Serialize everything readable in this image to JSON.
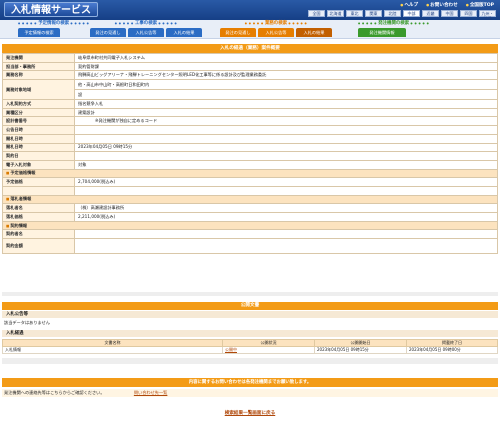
{
  "header": {
    "title": "入札情報サービス",
    "links": [
      "ヘルプ",
      "お問い合わせ",
      "全国版TOP"
    ],
    "regions": [
      [
        "全国",
        "北海道",
        "東北",
        "関東",
        "北陸",
        "中部",
        "近畿"
      ],
      [
        "中国",
        "四国",
        "九州・沖縄"
      ]
    ]
  },
  "nav": {
    "groups": [
      {
        "title": "予定情報の検索",
        "color": "#2b6cc4",
        "tabs": [
          "予定情報の検索"
        ]
      },
      {
        "title": "工事の検索",
        "color": "#2b6cc4",
        "tabs": [
          "発注の見通し",
          "入札公告等",
          "入札の結果"
        ]
      },
      {
        "title": "業務の検索",
        "color": "#e67e00",
        "tabs": [
          "発注の見通し",
          "入札公告等",
          "入札の結果"
        ]
      },
      {
        "title": "発注機関の検索",
        "color": "#3a9a2c",
        "tabs": [
          "発注機関情報"
        ]
      }
    ]
  },
  "main": {
    "title": "入札の経過（業務）案件概要",
    "rows": [
      {
        "label": "発注機関",
        "value": "岐阜県市町村共同電子入札システム"
      },
      {
        "label": "担当部・事務所",
        "value": "契約管財課"
      },
      {
        "label": "業務名称",
        "value": "飛騨高山ビッグアリーナ・飛騨トレーニングセンター照明LED化工事等に係る設計及び監理業務委託"
      },
      {
        "label": "業務対象地域",
        "value": "他・高山市中山町・高根町日和田町内"
      },
      {
        "label": "",
        "value": "設"
      },
      {
        "label": "入札契約方式",
        "value": "指名競争入札"
      },
      {
        "label": "業種区分",
        "value": "建築設計"
      },
      {
        "label": "設計書番号",
        "value": "※発注機関が独自に定めるコード"
      },
      {
        "label": "公告日時",
        "value": ""
      },
      {
        "label": "開札日時",
        "value": ""
      },
      {
        "label": "開札日時",
        "value": "2023年04月05日 09時15分"
      },
      {
        "label": "契約日",
        "value": ""
      },
      {
        "label": "電子入札対象",
        "value": "対象"
      }
    ],
    "section_price": "予定価格情報",
    "price_rows": [
      {
        "label": "予定価格",
        "value": "2,704,000(税込み)"
      },
      {
        "label": "",
        "value": ""
      }
    ],
    "section_winner": "落札者情報",
    "winner_rows": [
      {
        "label": "落札者名",
        "value": "（株）高瀬建設計事務所"
      },
      {
        "label": "落札価格",
        "value": "2,211,000(税込み)"
      }
    ],
    "section_contract": "契約情報",
    "contract_rows": [
      {
        "label": "契約者名",
        "value": ""
      },
      {
        "label": "契約金額",
        "value": ""
      }
    ]
  },
  "docs": {
    "title": "公開文書",
    "notice_head": "入札公告等",
    "notice_empty": "該当データはありません",
    "result_head": "入札経過",
    "columns": [
      "文書名称",
      "公開状況",
      "公開開始日",
      "掲載終了日"
    ],
    "rows": [
      {
        "name": "入札情報",
        "status": "公開中",
        "start": "2023年04月05日 09時15分",
        "end": "2023年04月05日 09時00分"
      }
    ]
  },
  "footer": {
    "notice": "内容に関するお問い合わせは各発注機関までお願い致します。",
    "contact": "発注機関への連絡先等はこちらからご確認ください。",
    "contact_link": "問い合わせ先一覧",
    "back": "検索結果一覧画面に戻る"
  }
}
